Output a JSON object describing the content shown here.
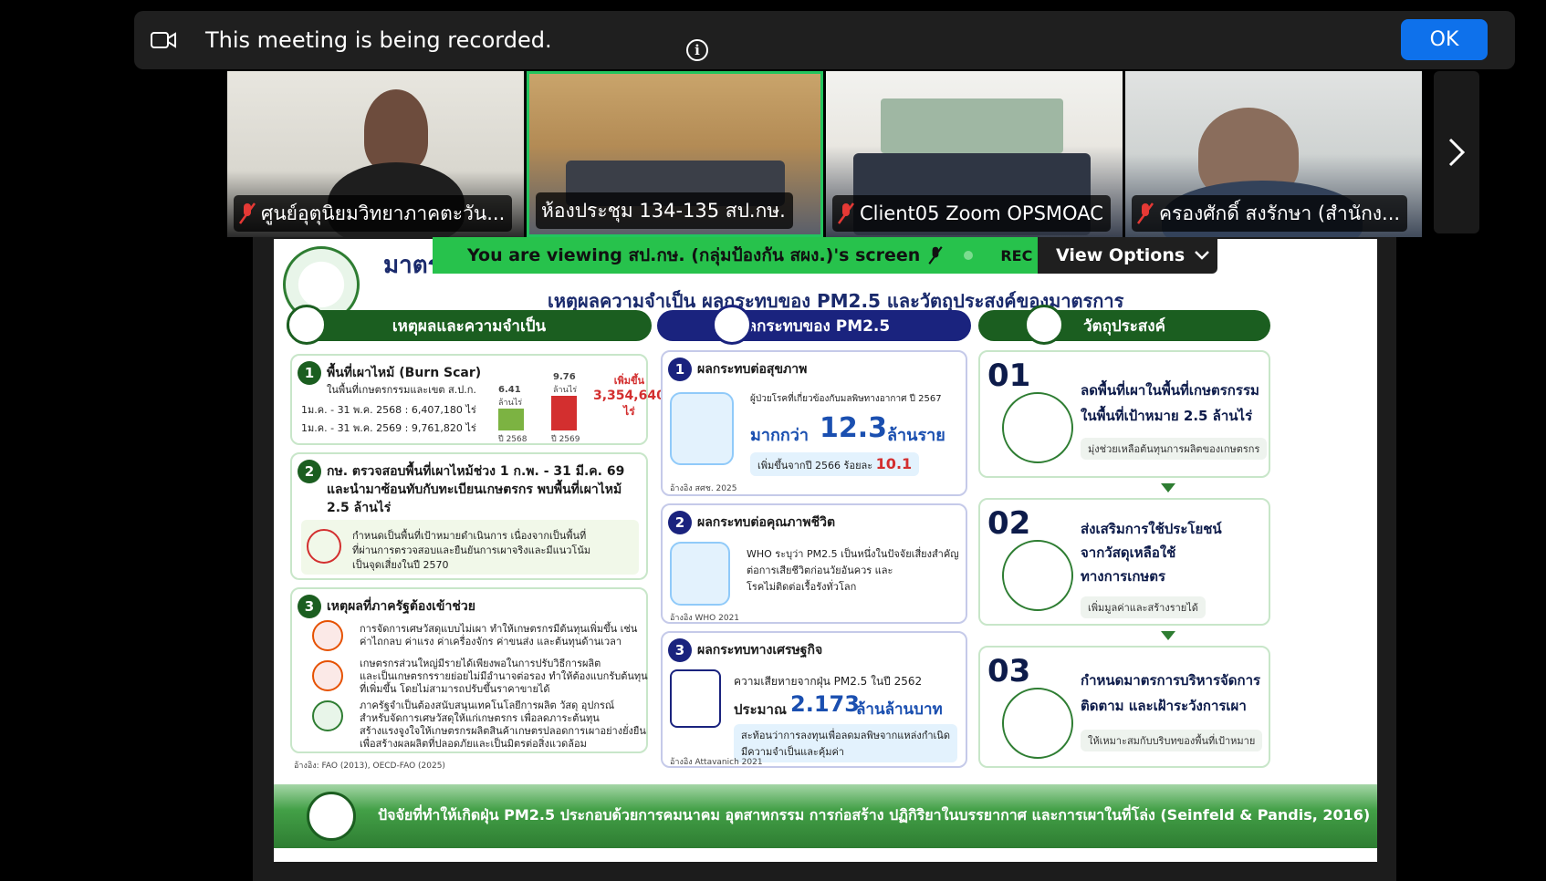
{
  "banner": {
    "message": "This meeting is being recorded.",
    "ok_label": "OK"
  },
  "participants": [
    {
      "name": "ศูนย์อุตุนิยมวิทยาภาคตะวัน..."
    },
    {
      "name": "ห้องประชุม 134-135 สป.กษ."
    },
    {
      "name": "Client05 Zoom OPSMOAC"
    },
    {
      "name": "ครองศักดิ์ สงรักษา (สำนักง..."
    }
  ],
  "share": {
    "viewing_text": "You are viewing  สป.กษ. (กลุ่มป้องกัน สผง.)'s screen",
    "rec_label": "REC",
    "view_options_label": "View Options"
  },
  "slide": {
    "title": "มาตรการ...",
    "subtitle": "เหตุผลความจำเป็น ผลกระทบของ PM2.5 และวัตถุประสงค์ของมาตรการ",
    "col1": {
      "head": "เหตุผลและความจำเป็น",
      "c1_title": "พื้นที่เผาไหม้ (Burn Scar)",
      "c1_sub": "ในพื้นที่เกษตรกรรมและเขต ส.ป.ก.",
      "c1_row1": "1ม.ค. - 31 พ.ค. 2568  :  6,407,180 ไร่",
      "c1_row2": "1ม.ค. - 31 พ.ค. 2569  :  9,761,820 ไร่",
      "bar1_val": "6.41",
      "bar2_val": "9.76",
      "bar_unit": "ล้านไร่",
      "bar1_label": "ปี 2568",
      "bar2_label": "ปี 2569",
      "inc_label": "เพิ่มขึ้น",
      "inc_value": "3,354,640",
      "inc_unit": "ไร่",
      "c2_title": "กษ. ตรวจสอบพื้นที่เผาไหม้ช่วง 1 ก.พ. - 31 มี.ค. 69",
      "c2_l2": "และนำมาซ้อนทับกับทะเบียนเกษตรกร พบพื้นที่เผาไหม้",
      "c2_l3": "2.5 ล้านไร่",
      "c2_n1": "กำหนดเป็นพื้นที่เป้าหมายดำเนินการ เนื่องจากเป็นพื้นที่",
      "c2_n2": "ที่ผ่านการตรวจสอบและยืนยันการเผาจริงและมีแนวโน้ม",
      "c2_n3": "เป็นจุดเสี่ยงในปี 2570",
      "c3_title": "เหตุผลที่ภาครัฐต้องเข้าช่วย",
      "c3_a": "การจัดการเศษวัสดุแบบไม่เผา ทำให้เกษตรกรมีต้นทุนเพิ่มขึ้น เช่น",
      "c3_a2": "ค่าไถกลบ ค่าแรง ค่าเครื่องจักร ค่าขนส่ง และต้นทุนด้านเวลา",
      "c3_b": "เกษตรกรส่วนใหญ่มีรายได้เพียงพอในการปรับวิธีการผลิต",
      "c3_b2": "และเป็นเกษตรกรรายย่อยไม่มีอำนาจต่อรอง ทำให้ต้องแบกรับต้นทุน",
      "c3_b3": "ที่เพิ่มขึ้น โดยไม่สามารถปรับขึ้นราคาขายได้",
      "c3_c": "ภาครัฐจำเป็นต้องสนับสนุนเทคโนโลยีการผลิต วัสดุ อุปกรณ์",
      "c3_c2": "สำหรับจัดการเศษวัสดุให้แก่เกษตรกร เพื่อลดภาระต้นทุน",
      "c3_c3": "สร้างแรงจูงใจให้เกษตรกรผลิตสินค้าเกษตรปลอดการเผาอย่างยั่งยืน",
      "c3_c4": "เพื่อสร้างผลผลิตที่ปลอดภัยและเป็นมิตรต่อสิ่งแวดล้อม",
      "ref": "อ้างอิง: FAO (2013), OECD-FAO (2025)"
    },
    "col2": {
      "head": "ผลกระทบของ PM2.5",
      "c1_title": "ผลกระทบต่อสุขภาพ",
      "c1_line": "ผู้ป่วยโรคที่เกี่ยวข้องกับมลพิษทางอากาศ ปี 2567",
      "c1_big_prefix": "มากกว่า",
      "c1_big": "12.3",
      "c1_big_unit": "ล้านราย",
      "c1_pill": "เพิ่มขึ้นจากปี 2566 ร้อยละ",
      "c1_pill_val": "10.1",
      "c1_ref": "อ้างอิง สศช. 2025",
      "c2_title": "ผลกระทบต่อคุณภาพชีวิต",
      "c2_l1": "WHO ระบุว่า PM2.5 เป็นหนึ่งในปัจจัยเสี่ยงสำคัญ",
      "c2_l2": "ต่อการเสียชีวิตก่อนวัยอันควร และ",
      "c2_l3": "โรคไม่ติดต่อเรื้อรังทั่วโลก",
      "c2_ref": "อ้างอิง WHO 2021",
      "c3_title": "ผลกระทบทางเศรษฐกิจ",
      "c3_l1": "ความเสียหายจากฝุ่น PM2.5 ในปี 2562",
      "c3_big_prefix": "ประมาณ",
      "c3_big": "2.173",
      "c3_big_unit": "ล้านล้านบาท",
      "c3_p1": "สะท้อนว่าการลงทุนเพื่อลดมลพิษจากแหล่งกำเนิด",
      "c3_p2": "มีความจำเป็นและคุ้มค่า",
      "c3_ref": "อ้างอิง Attavanich 2021"
    },
    "col3": {
      "head": "วัตถุประสงค์",
      "o1_num": "01",
      "o1_t1": "ลดพื้นที่เผาในพื้นที่เกษตรกรรม",
      "o1_t2": "ในพื้นที่เป้าหมาย 2.5 ล้านไร่",
      "o1_tag": "มุ่งช่วยเหลือต้นทุนการผลิตของเกษตรกร",
      "o2_num": "02",
      "o2_t1": "ส่งเสริมการใช้ประโยชน์",
      "o2_t2": "จากวัสดุเหลือใช้",
      "o2_t3": "ทางการเกษตร",
      "o2_tag": "เพิ่มมูลค่าและสร้างรายได้",
      "o3_num": "03",
      "o3_t1": "กำหนดมาตรการบริหารจัดการ",
      "o3_t2": "ติดตาม และเฝ้าระวังการเผา",
      "o3_tag": "ให้เหมาะสมกับบริบทของพื้นที่เป้าหมาย"
    },
    "footer": "ปัจจัยที่ทำให้เกิดฝุ่น PM2.5 ประกอบด้วยการคมนาคม อุตสาหกรรม การก่อสร้าง ปฏิกิริยาในบรรยากาศ และการเผาในที่โล่ง (Seinfeld & Pandis, 2016)"
  },
  "colors": {
    "ok_button": "#0e71eb",
    "active_border": "#22c55e",
    "viewing_bar": "#27c24c"
  }
}
